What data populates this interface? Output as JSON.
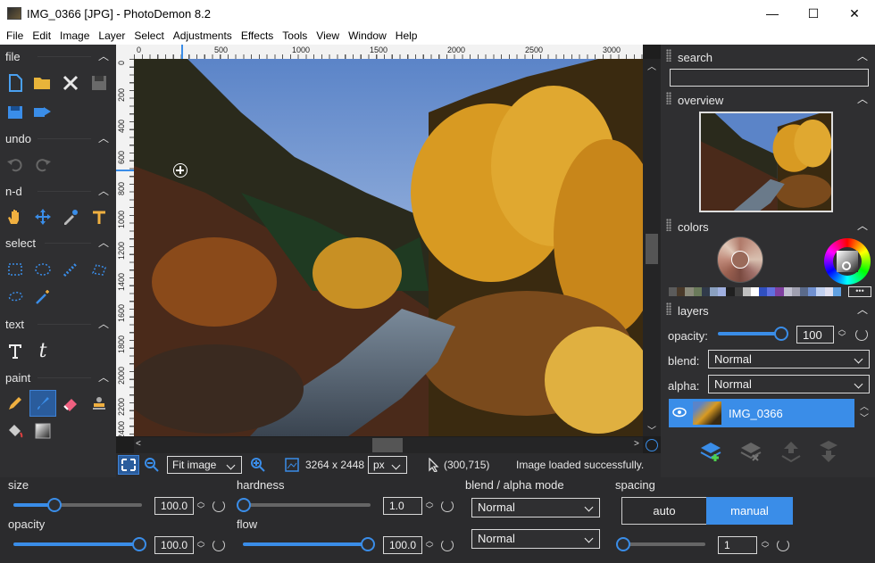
{
  "window": {
    "title": "IMG_0366 [JPG]  -  PhotoDemon 8.2",
    "minimize": "—",
    "maximize": "☐",
    "close": "✕"
  },
  "menu": [
    "File",
    "Edit",
    "Image",
    "Layer",
    "Select",
    "Adjustments",
    "Effects",
    "Tools",
    "View",
    "Window",
    "Help"
  ],
  "toolbox": {
    "sections": {
      "file": "file",
      "undo": "undo",
      "nd": "n-d",
      "select": "select",
      "text": "text",
      "paint": "paint"
    }
  },
  "ruler": {
    "h_ticks": [
      "0",
      "500",
      "1000",
      "1500",
      "2000",
      "2500",
      "3000"
    ],
    "v_ticks": [
      "0",
      "200",
      "400",
      "600",
      "800",
      "1000",
      "1200",
      "1400",
      "1600",
      "1800",
      "2000",
      "2200",
      "2400"
    ]
  },
  "canvas_status": {
    "zoom": "Fit image",
    "size": "3264 x 2448",
    "unit": "px",
    "coords": "(300,715)",
    "message": "Image loaded successfully."
  },
  "panels": {
    "search": {
      "label": "search",
      "value": ""
    },
    "overview": {
      "label": "overview"
    },
    "colors": {
      "label": "colors"
    },
    "layers": {
      "label": "layers",
      "opacity_label": "opacity:",
      "opacity_value": "100",
      "blend_label": "blend:",
      "blend_value": "Normal",
      "alpha_label": "alpha:",
      "alpha_value": "Normal",
      "layer_name": "IMG_0366"
    }
  },
  "brush_options": {
    "size_label": "size",
    "size_value": "100.0",
    "opacity_label": "opacity",
    "opacity_value": "100.0",
    "hardness_label": "hardness",
    "hardness_value": "1.0",
    "flow_label": "flow",
    "flow_value": "100.0",
    "blend_alpha_label": "blend / alpha mode",
    "blend_value": "Normal",
    "alpha_value": "Normal",
    "spacing_label": "spacing",
    "spacing_auto": "auto",
    "spacing_manual": "manual",
    "spacing_value": "1"
  },
  "colors": {
    "accent": "#3a8de8",
    "panel": "#2f2f31",
    "selected_layer": "#3a8de8"
  },
  "palette": [
    "#5b5b5b",
    "#4a3a2a",
    "#8a8a7a",
    "#6a7a5a",
    "#303a4a",
    "#8aa0c0",
    "#a0b0e0",
    "#202020",
    "#404040",
    "#c0c0c0",
    "#ffffff",
    "#3050c0",
    "#6070e0",
    "#8040a0",
    "#c0c0d0",
    "#a0a0b0",
    "#5a6a8a",
    "#7090d0",
    "#c0d0f0",
    "#e0e0f0",
    "#60a0e0"
  ]
}
